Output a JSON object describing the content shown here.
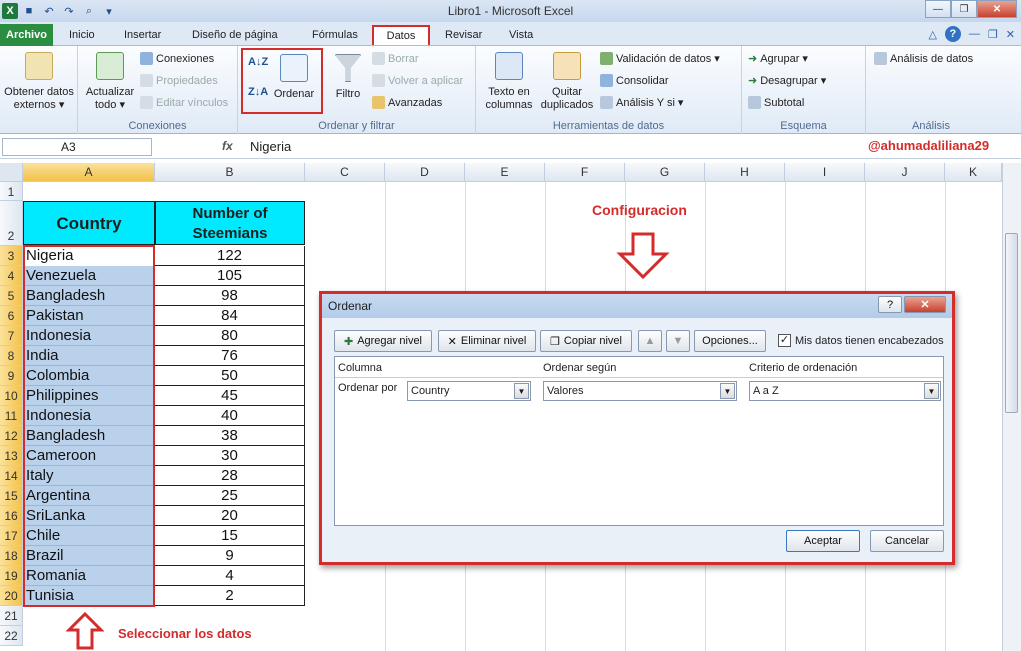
{
  "window": {
    "title": "Libro1  -  Microsoft Excel"
  },
  "tabs": {
    "file": "Archivo",
    "inicio": "Inicio",
    "insertar": "Insertar",
    "diseno": "Diseño de página",
    "formulas": "Fórmulas",
    "datos": "Datos",
    "revisar": "Revisar",
    "vista": "Vista"
  },
  "ribbon": {
    "ext": {
      "label": "Obtener datos externos"
    },
    "conexiones": {
      "refresh": "Actualizar todo",
      "conexiones": "Conexiones",
      "propiedades": "Propiedades",
      "editar": "Editar vínculos",
      "group": "Conexiones"
    },
    "ordenar": {
      "ordenar": "Ordenar",
      "filtro": "Filtro",
      "borrar": "Borrar",
      "volver": "Volver a aplicar",
      "avanzadas": "Avanzadas",
      "group": "Ordenar y filtrar"
    },
    "herramientas": {
      "texto": "Texto en columnas",
      "quitar": "Quitar duplicados",
      "validacion": "Validación de datos",
      "consolidar": "Consolidar",
      "analisis_y_si": "Análisis Y si",
      "group": "Herramientas de datos"
    },
    "esquema": {
      "agrupar": "Agrupar",
      "desagrupar": "Desagrupar",
      "subtotal": "Subtotal",
      "group": "Esquema"
    },
    "analisis": {
      "btn": "Análisis de datos",
      "group": "Análisis"
    }
  },
  "formula_bar": {
    "name_box": "A3",
    "fx": "fx",
    "value": "Nigeria",
    "handle": "@ahumadaliliana29"
  },
  "columns": [
    "A",
    "B",
    "C",
    "D",
    "E",
    "F",
    "G",
    "H",
    "I",
    "J",
    "K"
  ],
  "rows": [
    "1",
    "2",
    "3",
    "4",
    "5",
    "6",
    "7",
    "8",
    "9",
    "10",
    "11",
    "12",
    "13",
    "14",
    "15",
    "16",
    "17",
    "18",
    "19",
    "20",
    "21",
    "22"
  ],
  "table": {
    "header_a": "Country",
    "header_b_line1": "Number of",
    "header_b_line2": "Steemians",
    "data": [
      {
        "country": "Nigeria",
        "n": "122"
      },
      {
        "country": "Venezuela",
        "n": "105"
      },
      {
        "country": "Bangladesh",
        "n": "98"
      },
      {
        "country": "Pakistan",
        "n": "84"
      },
      {
        "country": "Indonesia",
        "n": "80"
      },
      {
        "country": "India",
        "n": "76"
      },
      {
        "country": "Colombia",
        "n": "50"
      },
      {
        "country": "Philippines",
        "n": "45"
      },
      {
        "country": "Indonesia",
        "n": "40"
      },
      {
        "country": "Bangladesh",
        "n": "38"
      },
      {
        "country": "Cameroon",
        "n": "30"
      },
      {
        "country": "Italy",
        "n": "28"
      },
      {
        "country": "Argentina",
        "n": "25"
      },
      {
        "country": "SriLanka",
        "n": "20"
      },
      {
        "country": "Chile",
        "n": "15"
      },
      {
        "country": "Brazil",
        "n": "9"
      },
      {
        "country": "Romania",
        "n": "4"
      },
      {
        "country": "Tunisia",
        "n": "2"
      }
    ]
  },
  "annotations": {
    "config": "Configuracion",
    "select": "Seleccionar los datos"
  },
  "dialog": {
    "title": "Ordenar",
    "add_level": "Agregar nivel",
    "delete_level": "Eliminar nivel",
    "copy_level": "Copiar nivel",
    "options": "Opciones...",
    "headers_check": "Mis datos tienen encabezados",
    "col_header": "Columna",
    "sort_on_header": "Ordenar según",
    "order_header": "Criterio de ordenación",
    "sort_by": "Ordenar por",
    "column_value": "Country",
    "sort_on_value": "Valores",
    "order_value": "A a Z",
    "ok": "Aceptar",
    "cancel": "Cancelar"
  },
  "colors": {
    "accent_red": "#d42b2b",
    "header_fill": "#00eaff",
    "selection": "#bad1ec"
  }
}
